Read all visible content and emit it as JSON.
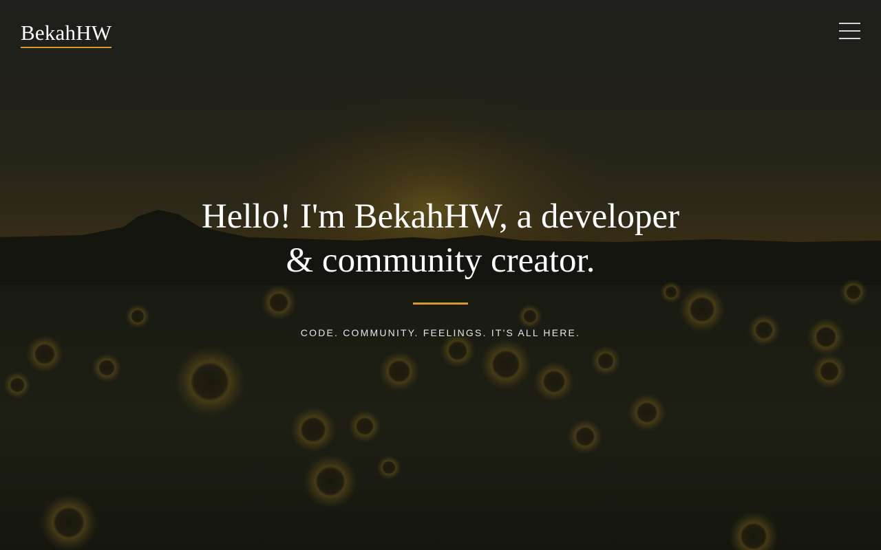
{
  "header": {
    "brand": "BekahHW",
    "menu_icon": "hamburger-menu-icon"
  },
  "hero": {
    "title_line1": "Hello! I'm BekahHW, a developer",
    "title_line2": "& community creator.",
    "tagline": "CODE. COMMUNITY. FEELINGS. IT'S ALL HERE.",
    "background_image": "sunflower field at sunset"
  },
  "colors": {
    "accent": "#d99a2b",
    "text": "#ffffff",
    "background": "#1b1c14"
  }
}
